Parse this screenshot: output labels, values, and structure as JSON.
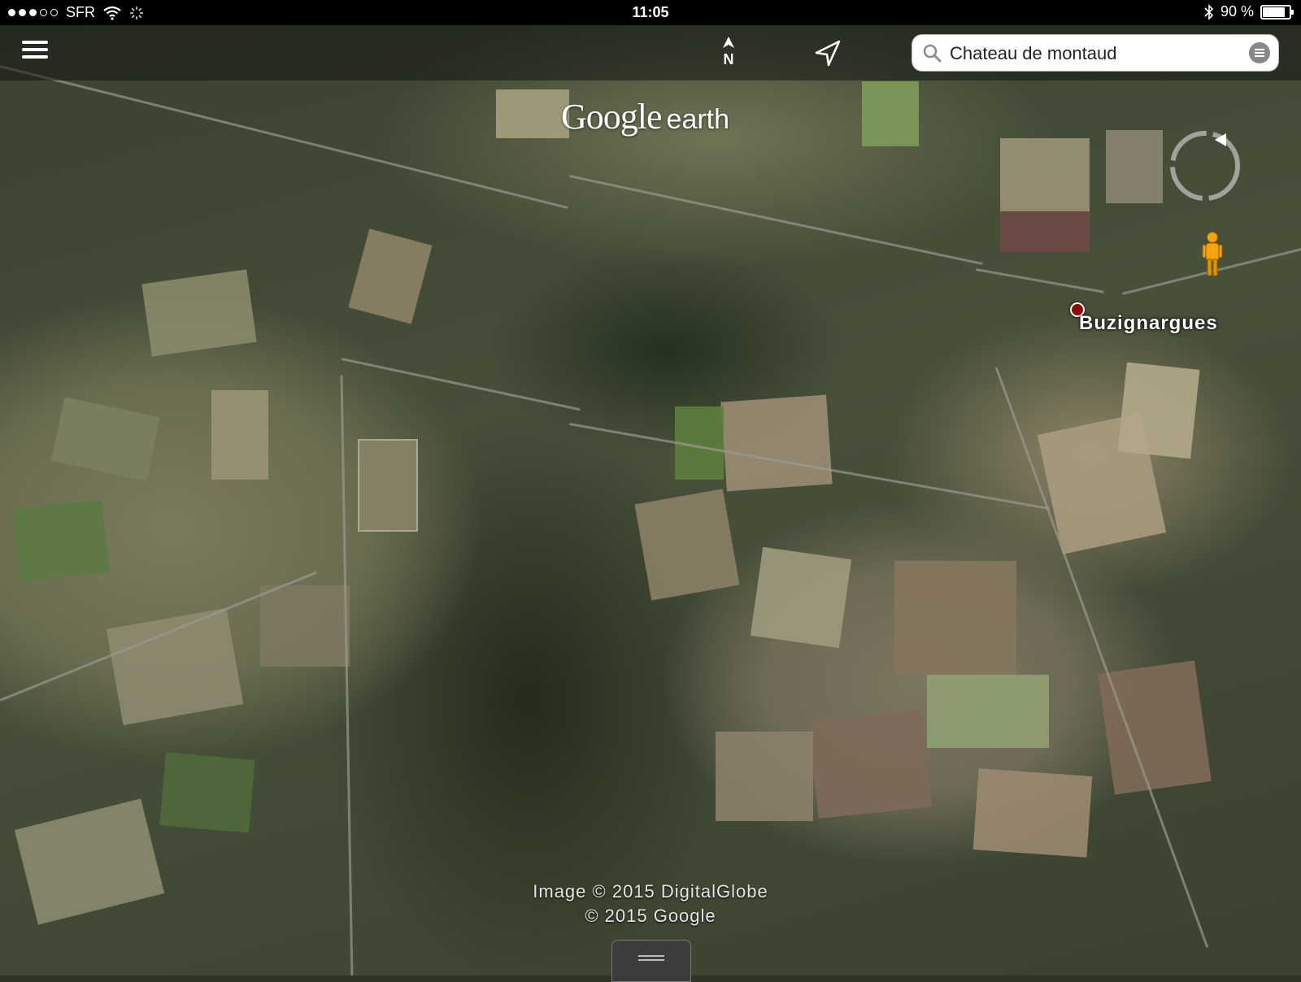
{
  "status_bar": {
    "carrier": "SFR",
    "time": "11:05",
    "battery_text": "90 %",
    "battery_level": 0.9,
    "signal_bars": 3
  },
  "toolbar": {
    "north_label": "N",
    "search": {
      "value": "Chateau de montaud"
    }
  },
  "logo": {
    "google": "Google",
    "earth": "earth"
  },
  "map": {
    "place_label": "Buzignargues",
    "marker_color": "#8b0d0d"
  },
  "attribution": {
    "line1": "Image © 2015 DigitalGlobe",
    "line2": "© 2015 Google"
  }
}
